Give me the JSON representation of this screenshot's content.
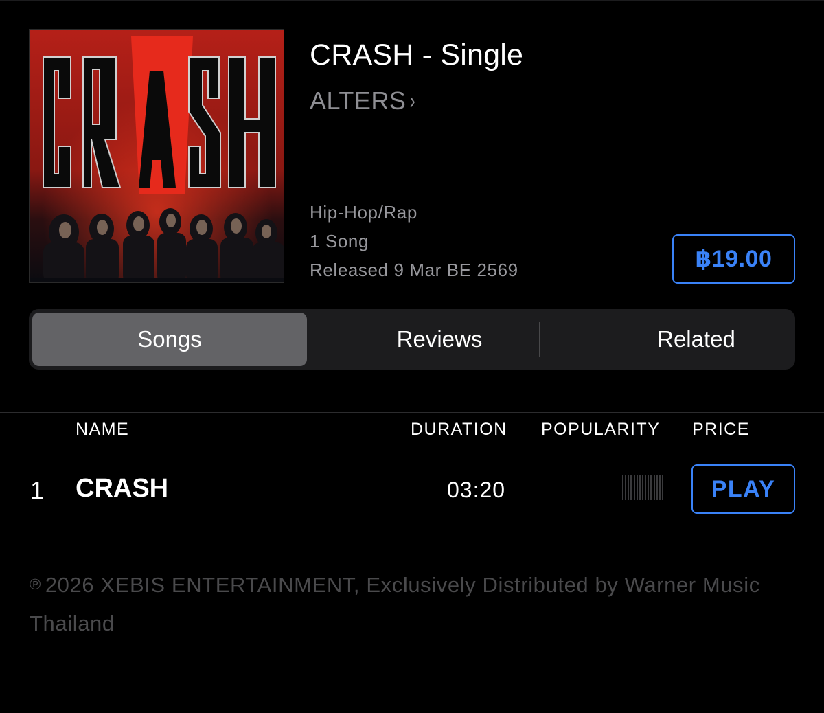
{
  "album": {
    "title": "CRASH - Single",
    "artist": "ALTERS",
    "artist_chevron": "›",
    "genre": "Hip-Hop/Rap",
    "song_count": "1 Song",
    "released": "Released 9 Mar BE 2569",
    "price": "฿19.00",
    "artwork_text": "CRASH"
  },
  "tabs": [
    {
      "label": "Songs",
      "active": true
    },
    {
      "label": "Reviews",
      "active": false
    },
    {
      "label": "Related",
      "active": false
    }
  ],
  "table": {
    "headers": {
      "name": "NAME",
      "duration": "DURATION",
      "popularity": "POPULARITY",
      "price": "PRICE"
    },
    "rows": [
      {
        "number": "1",
        "name": "CRASH",
        "duration": "03:20",
        "popularity_fraction": 0,
        "action": "PLAY"
      }
    ]
  },
  "footer": {
    "symbol": "℗",
    "copyright": "2026 XEBIS ENTERTAINMENT, Exclusively Distributed by Warner Music Thailand"
  },
  "colors": {
    "background": "#000000",
    "accent": "#3a82f7",
    "secondary_text": "#8e8e93",
    "segmented_bg": "#1c1c1e",
    "segmented_active": "#636366"
  }
}
